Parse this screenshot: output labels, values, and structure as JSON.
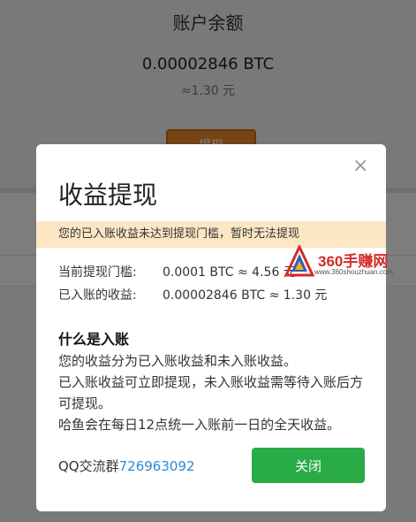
{
  "background": {
    "title": "账户余额",
    "balance": "0.00002846 BTC",
    "approx": "≈1.30 元",
    "withdraw_label": "提现"
  },
  "modal": {
    "close_icon": "×",
    "title": "收益提现",
    "warning": "您的已入账收益未达到提现门槛，暂时无法提现",
    "threshold_label": "当前提现门槛:",
    "threshold_value": "0.0001 BTC ≈ 4.56 元",
    "earned_label": "已入账的收益:",
    "earned_value": "0.00002846 BTC ≈ 1.30 元",
    "section_heading": "什么是入账",
    "desc_1": "您的收益分为已入账收益和未入账收益。",
    "desc_2": "已入账收益可立即提现，未入账收益需等待入账后方可提现。",
    "desc_3": "哈鱼会在每日12点统一入账前一日的全天收益。",
    "qq_label": "QQ交流群",
    "qq_number": "726963092",
    "close_button": "关闭"
  },
  "watermark": {
    "text": "360手赚网",
    "sub": "www.360shouzhuan.com"
  },
  "colors": {
    "warning_bg": "#fde6c4",
    "close_button_bg": "#29ac48",
    "link_blue": "#2b8bd6",
    "withdraw_orange": "#e8882a"
  }
}
